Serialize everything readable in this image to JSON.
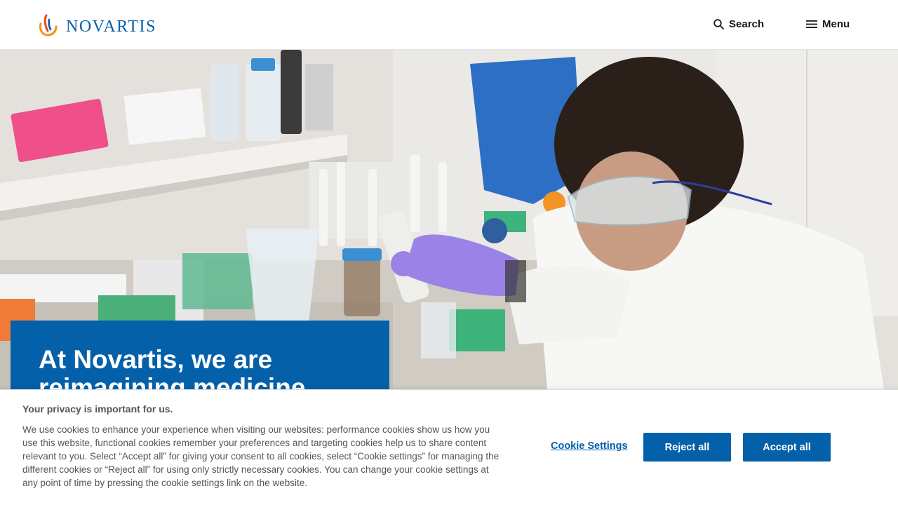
{
  "header": {
    "logo_text": "NOVARTIS",
    "search_label": "Search",
    "menu_label": "Menu"
  },
  "hero": {
    "title": "At Novartis, we are reimagining medicine"
  },
  "cookie_banner": {
    "title": "Your privacy is important for us.",
    "body": "We use cookies to enhance your experience when visiting our websites: performance cookies show us how you use this website, functional cookies remember your preferences and targeting cookies help us to share content relevant to you. Select “Accept all” for giving your consent to all cookies, select “Cookie settings” for managing the different cookies or “Reject all” for using only strictly necessary cookies. You can change your cookie settings at any point of time by pressing the cookie settings link on the website.",
    "settings_label": "Cookie Settings",
    "reject_label": "Reject all",
    "accept_label": "Accept all"
  },
  "colors": {
    "brand_blue": "#0460a9",
    "logo_orange": "#ec9a1e",
    "logo_red": "#e74a21"
  },
  "icons": {
    "search": "search-icon",
    "menu": "hamburger-icon",
    "logo": "novartis-flame-icon"
  }
}
